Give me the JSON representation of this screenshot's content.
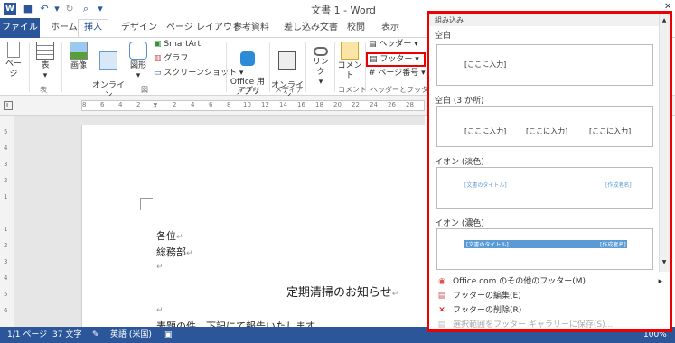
{
  "title_bar": {
    "doc_title": "文書 1 - Word"
  },
  "tabs": [
    {
      "label": "ファイル"
    },
    {
      "label": "ホーム"
    },
    {
      "label": "挿入"
    },
    {
      "label": "デザイン"
    },
    {
      "label": "ページ レイアウト"
    },
    {
      "label": "参考資料"
    },
    {
      "label": "差し込み文書"
    },
    {
      "label": "校閲"
    },
    {
      "label": "表示"
    }
  ],
  "ribbon": {
    "page_label": "ページ",
    "table_label": "表",
    "image_label": "画像",
    "online_image_label": "オンライン\n画像",
    "shapes_label": "図形",
    "smartart_label": "SmartArt",
    "graph_label": "グラフ",
    "screenshot_label": "スクリーンショット",
    "office_app_label": "Office 用\nアプリ",
    "online_video_label": "オンライン\nビデオ",
    "link_label": "リンク",
    "comment_label": "コメント",
    "header_label": "ヘッダー",
    "footer_label": "フッター",
    "page_number_label": "ページ番号",
    "group_table": "表",
    "group_figure": "図",
    "group_app": "アプリ",
    "group_media": "メディア",
    "group_comment": "コメント",
    "group_header_footer": "ヘッダーとフッター"
  },
  "ruler": {
    "numbers": [
      "8",
      "6",
      "4",
      "2",
      "",
      "2",
      "4",
      "6",
      "8",
      "10",
      "12",
      "14",
      "16",
      "18",
      "20",
      "22",
      "24",
      "26",
      "28"
    ]
  },
  "vruler": {
    "numbers": [
      "5",
      "4",
      "3",
      "2",
      "1",
      "",
      "1",
      "2",
      "3",
      "4",
      "5",
      "6",
      "7"
    ]
  },
  "document": {
    "line1": "各位",
    "line2": "総務部",
    "heading": "定期清掃のお知らせ",
    "body": "表題の件、下記にて報告いたします。",
    "para_mark": "↵"
  },
  "status": {
    "page": "1/1 ページ",
    "words": "37 文字",
    "lang": "英語 (米国)",
    "zoom": "100%"
  },
  "gallery": {
    "section_header": "組み込み",
    "items": [
      {
        "title": "空白",
        "placeholder": "[ここに入力]"
      },
      {
        "title": "空白 (3 か所)",
        "placeholder": "[ここに入力]"
      },
      {
        "title": "イオン (淡色)",
        "left": "[文書のタイトル]",
        "right": "[作成者名]"
      },
      {
        "title": "イオン (濃色)",
        "left": "[文書のタイトル]",
        "right": "[作成者名]"
      }
    ],
    "menu": [
      {
        "label": "Office.com のその他のフッター(M)"
      },
      {
        "label": "フッターの編集(E)"
      },
      {
        "label": "フッターの削除(R)"
      },
      {
        "label": "選択範囲をフッター ギャラリーに保存(S)..."
      }
    ]
  }
}
